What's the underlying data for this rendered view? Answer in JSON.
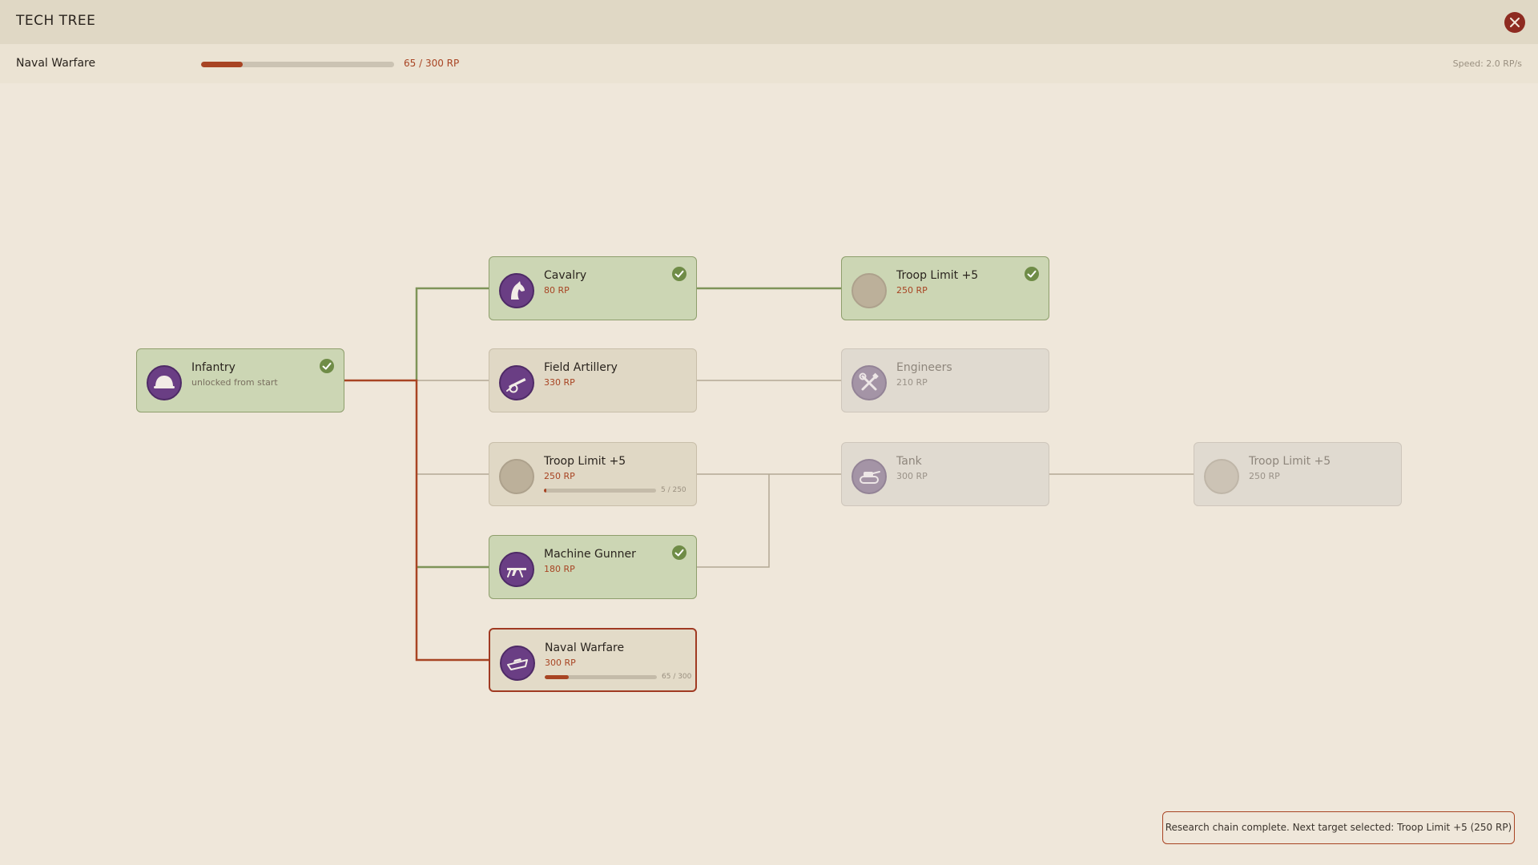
{
  "window": {
    "title": "TECH TREE"
  },
  "status": {
    "current_label": "Naval Warfare",
    "progress": 0.2167,
    "progress_text": "65 / 300 RP",
    "speed_text": "Speed: 2.0 RP/s"
  },
  "nodes": {
    "infantry": {
      "name": "Infantry",
      "sub": "unlocked from start",
      "state": "done",
      "icon": "helmet-icon"
    },
    "cavalry": {
      "name": "Cavalry",
      "cost": "80 RP",
      "state": "done",
      "icon": "horse-icon"
    },
    "troop1": {
      "name": "Troop Limit +5",
      "cost": "250 RP",
      "state": "done",
      "icon": "troop-icon"
    },
    "field_artillery": {
      "name": "Field Artillery",
      "cost": "330 RP",
      "state": "available",
      "icon": "cannon-icon"
    },
    "engineers": {
      "name": "Engineers",
      "cost": "210 RP",
      "state": "locked",
      "icon": "tools-icon"
    },
    "troop2": {
      "name": "Troop Limit +5",
      "cost": "250 RP",
      "state": "available",
      "icon": "troop-icon",
      "progress": 0.02,
      "progress_text": "5 / 250"
    },
    "tank": {
      "name": "Tank",
      "cost": "300 RP",
      "state": "locked",
      "icon": "tank-icon"
    },
    "troop3": {
      "name": "Troop Limit +5",
      "cost": "250 RP",
      "state": "locked",
      "icon": "troop-icon"
    },
    "machine_gunner": {
      "name": "Machine Gunner",
      "cost": "180 RP",
      "state": "done",
      "icon": "machine-gun-icon"
    },
    "naval_warfare": {
      "name": "Naval Warfare",
      "cost": "300 RP",
      "state": "researching",
      "icon": "ship-icon",
      "progress": 0.2167,
      "progress_text": "65 / 300"
    }
  },
  "toast": {
    "text": "Research chain complete. Next target selected: Troop Limit +5 (250 RP)"
  },
  "colors": {
    "accent": "#A84423",
    "done_bg": "#CCD6B4",
    "done_edge": "#7E9458",
    "check": "#6F8C47",
    "icon_purple": "#6A3E84",
    "close": "#8E2B21"
  }
}
